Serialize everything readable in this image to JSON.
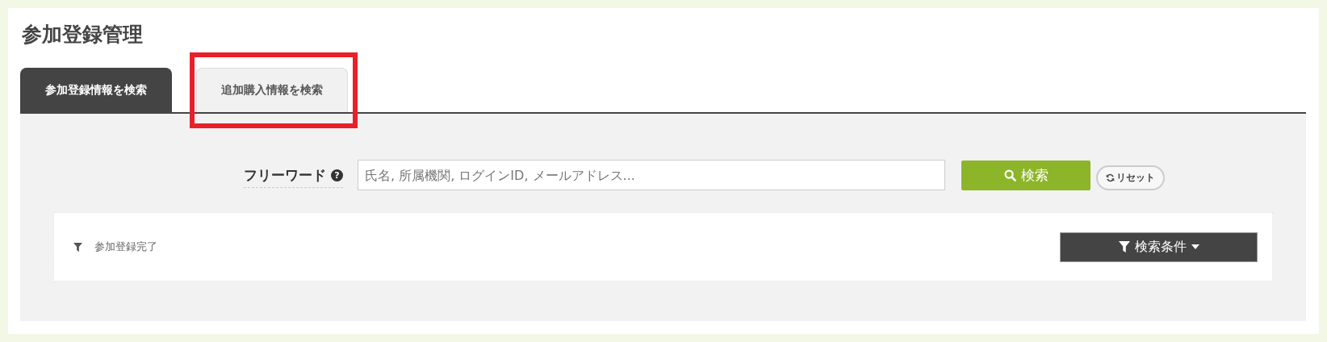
{
  "page_title": "参加登録管理",
  "tabs": [
    {
      "label": "参加登録情報を検索",
      "selected": true,
      "highlighted": false
    },
    {
      "label": "追加購入情報を検索",
      "selected": false,
      "highlighted": true
    }
  ],
  "search": {
    "label": "フリーワード",
    "help_icon": "?",
    "placeholder": "氏名, 所属機関, ログインID, メールアドレス...",
    "search_button": "検索",
    "reset_button": "リセット"
  },
  "filter": {
    "summary": "参加登録完了",
    "conditions_button": "検索条件"
  }
}
